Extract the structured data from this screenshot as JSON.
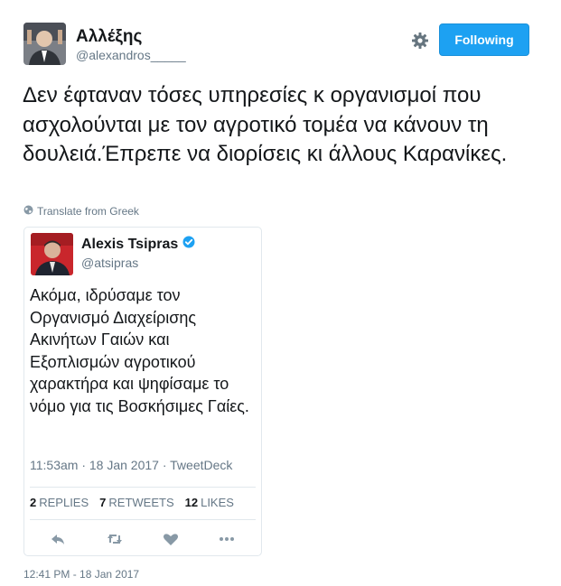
{
  "author": {
    "name": "Αλλέξης",
    "handle": "@alexandros_____"
  },
  "header": {
    "follow_label": "Following"
  },
  "tweet": {
    "text": "Δεν έφταναν τόσες υπηρεσίες κ οργανισμοί που ασχολούνται με τον αγροτικό τομέα να κάνουν τη δουλειά.Έπρεπε να διορίσεις κι άλλους Καρανίκες.",
    "translate_label": "Translate from Greek",
    "timestamp": "12:41 PM - 18 Jan 2017"
  },
  "quoted": {
    "name": "Alexis Tsipras",
    "handle": "@atsipras",
    "text": "Ακόμα, ιδρύσαμε τον Οργανισμό Διαχείρισης Ακινήτων Γαιών και Εξοπλισμών αγροτικού χαρακτήρα και ψηφίσαμε το νόμο για τις Βοσκήσιμες Γαίες.",
    "meta": "11:53am · 18 Jan 2017 · TweetDeck",
    "replies_count": "2",
    "replies_label": "REPLIES",
    "retweets_count": "7",
    "retweets_label": "RETWEETS",
    "likes_count": "12",
    "likes_label": "LIKES"
  },
  "colors": {
    "accent": "#1da1f2",
    "muted": "#657786",
    "border": "#e1e8ed"
  },
  "icons": [
    "gear-icon",
    "globe-icon",
    "verified-icon",
    "reply-icon",
    "retweet-icon",
    "like-icon",
    "more-icon"
  ]
}
